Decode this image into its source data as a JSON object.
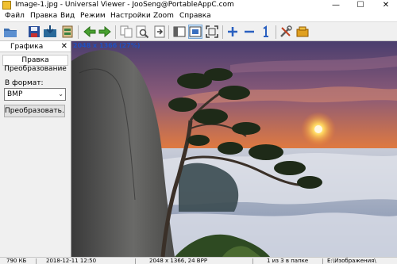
{
  "window": {
    "title": "Image-1.jpg - Universal Viewer - JooSeng@PortableAppC.com",
    "minimize_glyph": "—",
    "maximize_glyph": "☐",
    "close_glyph": "✕"
  },
  "menu": [
    "Файл",
    "Правка",
    "Вид",
    "Режим",
    "Настройки",
    "Zoom",
    "Справка"
  ],
  "toolbar": {
    "buttons": [
      "open-folder-icon",
      "save-icon",
      "save-as-icon",
      "print-icon",
      "back-arrow-icon",
      "forward-arrow-icon",
      "copy-icon",
      "find-icon",
      "export-icon",
      "fit-window-icon",
      "original-size-icon",
      "fullscreen-icon",
      "zoom-in-icon",
      "zoom-out-icon",
      "actual-size-icon",
      "tools-icon",
      "plugin-icon"
    ],
    "active": "original-size-icon"
  },
  "sidepanel": {
    "title": "Графика",
    "close_glyph": "✕",
    "tabs": [
      "Правка",
      "Преобразование"
    ],
    "selected_tab": "Правка",
    "format_label": "В формат:",
    "format_value": "BMP",
    "chevron_glyph": "⌄",
    "convert_button": "Преобразовать..."
  },
  "viewer": {
    "zoom_overlay": "2048 x 1366 (27%)"
  },
  "statusbar": {
    "file_size": "790 КБ",
    "date": "2018-12-11 12:50",
    "dimensions": "2048 x 1366, 24 BPP",
    "position": "1 из 3 в папке",
    "path": "E:\\Изображения\\"
  },
  "colors": {
    "accent_blue": "#2050c0",
    "zoom_text": "#2050c0",
    "sunset_orange": "#f08030",
    "sky_purple": "#5a4a7a"
  }
}
